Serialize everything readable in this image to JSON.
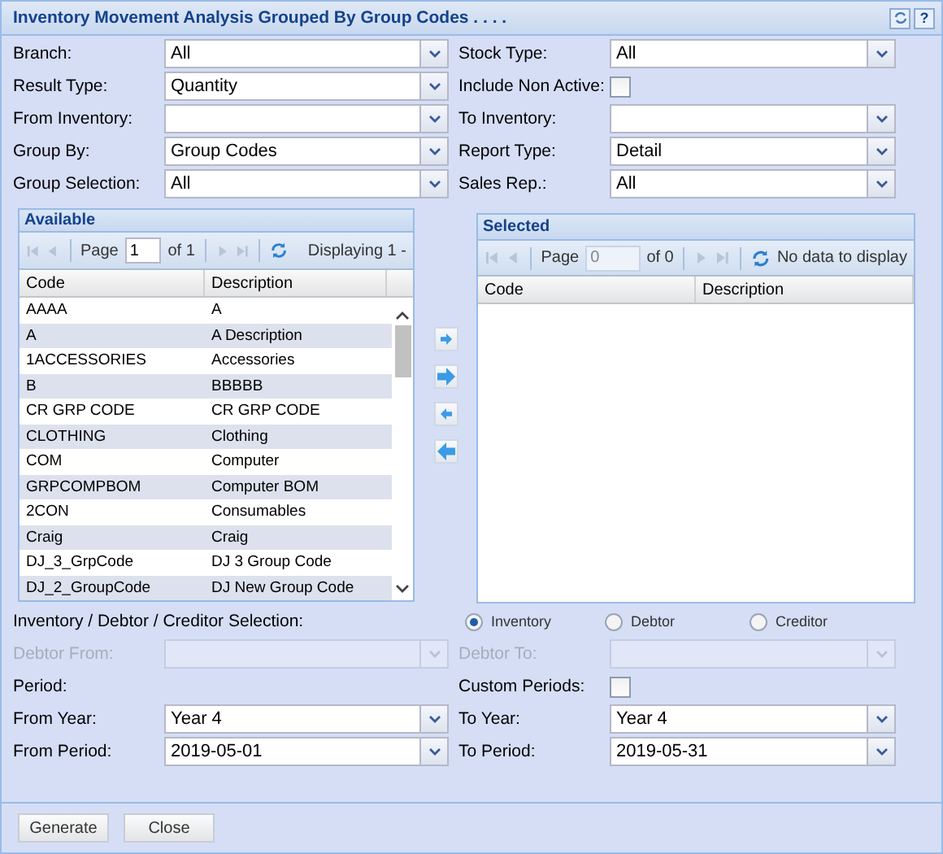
{
  "window": {
    "title": "Inventory Movement Analysis Grouped By Group Codes . . . .",
    "tools": [
      {
        "kind": "refresh"
      },
      {
        "kind": "help",
        "glyph": "?"
      }
    ]
  },
  "fields": [
    {
      "label": "Branch:",
      "kind": "combo",
      "value": "All"
    },
    {
      "label": "Stock Type:",
      "kind": "combo",
      "value": "All"
    },
    {
      "label": "Result Type:",
      "kind": "combo",
      "value": "Quantity"
    },
    {
      "label": "Include Non Active:",
      "kind": "checkbox",
      "checked": false
    },
    {
      "label": "From Inventory:",
      "kind": "combo"
    },
    {
      "label": "To Inventory:",
      "kind": "combo"
    },
    {
      "label": "Group By:",
      "kind": "combo",
      "value": "Group Codes"
    },
    {
      "label": "Report Type:",
      "kind": "combo",
      "value": "Detail"
    },
    {
      "label": "Group Selection:",
      "kind": "combo",
      "value": "All"
    },
    {
      "label": "Sales Rep.:",
      "kind": "combo",
      "value": "All"
    }
  ],
  "available": {
    "title": "Available",
    "pager": {
      "page_label": "Page",
      "page": "1",
      "of": "of 1",
      "info": "Displaying 1 -",
      "disabled": false
    },
    "columns": [
      "Code",
      "Description"
    ],
    "rows": [
      {
        "code": "AAAA",
        "description": "A"
      },
      {
        "code": "A",
        "description": "A Description"
      },
      {
        "code": "1ACCESSORIES",
        "description": "Accessories"
      },
      {
        "code": "B",
        "description": "BBBBB"
      },
      {
        "code": "CR GRP CODE",
        "description": "CR GRP CODE"
      },
      {
        "code": "CLOTHING",
        "description": "Clothing"
      },
      {
        "code": "COM",
        "description": "Computer"
      },
      {
        "code": "GRPCOMPBOM",
        "description": "Computer BOM"
      },
      {
        "code": "2CON",
        "description": "Consumables"
      },
      {
        "code": "Craig",
        "description": "Craig"
      },
      {
        "code": "DJ_3_GrpCode",
        "description": "DJ 3 Group Code"
      },
      {
        "code": "DJ_2_GroupCode",
        "description": "DJ New Group Code"
      }
    ]
  },
  "move_buttons": [
    {
      "kind": "add"
    },
    {
      "kind": "add_all"
    },
    {
      "kind": "remove"
    },
    {
      "kind": "remove_all"
    }
  ],
  "selected": {
    "title": "Selected",
    "pager": {
      "page_label": "Page",
      "page": "0",
      "of": "of 0",
      "info": "No data to display",
      "disabled": true
    },
    "columns": [
      "Code",
      "Description"
    ]
  },
  "selection": {
    "label": "Inventory / Debtor / Creditor Selection:",
    "options": [
      {
        "label": "Inventory",
        "selected": true
      },
      {
        "label": "Debtor",
        "selected": false
      },
      {
        "label": "Creditor",
        "selected": false
      }
    ]
  },
  "lower_fields": [
    {
      "label": "Debtor From:",
      "kind": "combo",
      "disabled": true
    },
    {
      "label": "Debtor To:",
      "kind": "combo",
      "disabled": true
    },
    {
      "label": "Period:",
      "kind": "heading"
    },
    {
      "label": "Custom Periods:",
      "kind": "checkbox",
      "checked": false
    },
    {
      "label": "From Year:",
      "kind": "combo",
      "value": "Year 4"
    },
    {
      "label": "To Year:",
      "kind": "combo",
      "value": "Year 4"
    },
    {
      "label": "From Period:",
      "kind": "combo",
      "value": "2019-05-01"
    },
    {
      "label": "To Period:",
      "kind": "combo",
      "value": "2019-05-31"
    }
  ],
  "buttons": [
    "Generate",
    "Close"
  ]
}
